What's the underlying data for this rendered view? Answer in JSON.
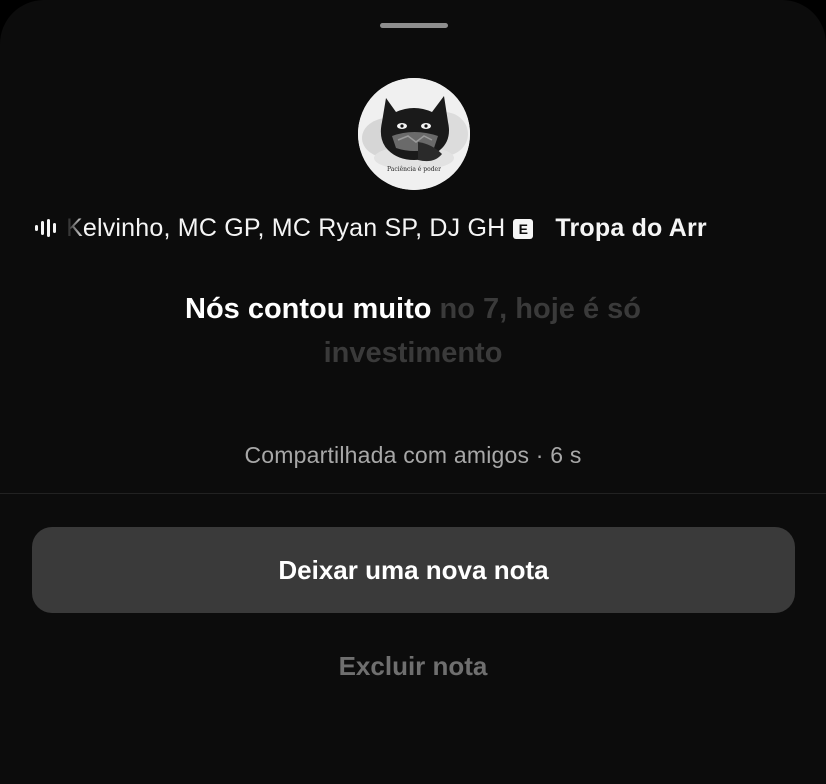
{
  "avatar": {
    "caption": "Paciência é poder"
  },
  "music": {
    "icon": "audio-waveform-icon",
    "artists": "Kelvinho, MC GP, MC Ryan SP, DJ GH",
    "explicit_badge": "E",
    "song_title": "Tropa do Arr"
  },
  "lyrics": {
    "active": "Nós contou muito",
    "upcoming": "no 7, hoje é só investimento"
  },
  "note_meta": {
    "shared_text": "Compartilhada com amigos · 6 s"
  },
  "actions": {
    "new_note_label": "Deixar uma nova nota",
    "delete_note_label": "Excluir nota"
  },
  "colors": {
    "background": "#0c0c0c",
    "primary_button": "#3a3a3a",
    "muted_text": "#a8a8a8",
    "faded_lyric": "#3a3a3a",
    "destructive_disabled": "#6f6f6f"
  }
}
